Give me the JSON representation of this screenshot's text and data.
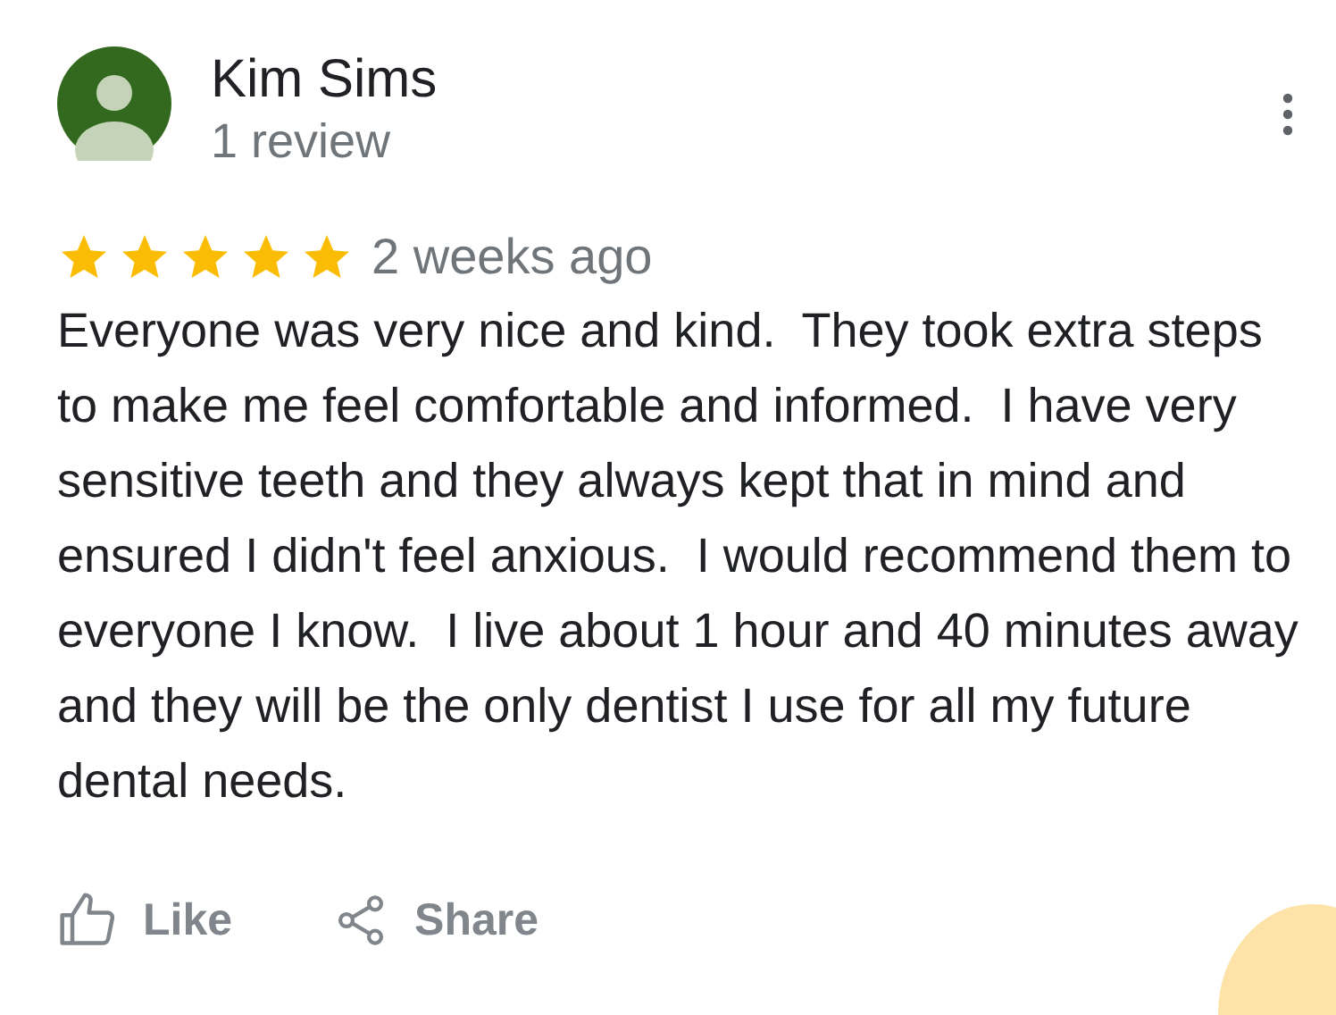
{
  "reviewer": {
    "name": "Kim Sims",
    "review_count": "1 review"
  },
  "review": {
    "stars": 5,
    "time": "2 weeks ago",
    "text": "Everyone was very nice and kind.  They took extra steps to make me feel comfortable and informed.  I have very sensitive teeth and they always kept that in mind and ensured I didn't feel anxious.  I would recommend them to everyone I know.  I live about 1 hour and 40 minutes away and they will be the only dentist I use for all my future dental needs."
  },
  "actions": [
    {
      "kind": "like",
      "label": "Like"
    },
    {
      "kind": "share",
      "label": "Share"
    }
  ]
}
